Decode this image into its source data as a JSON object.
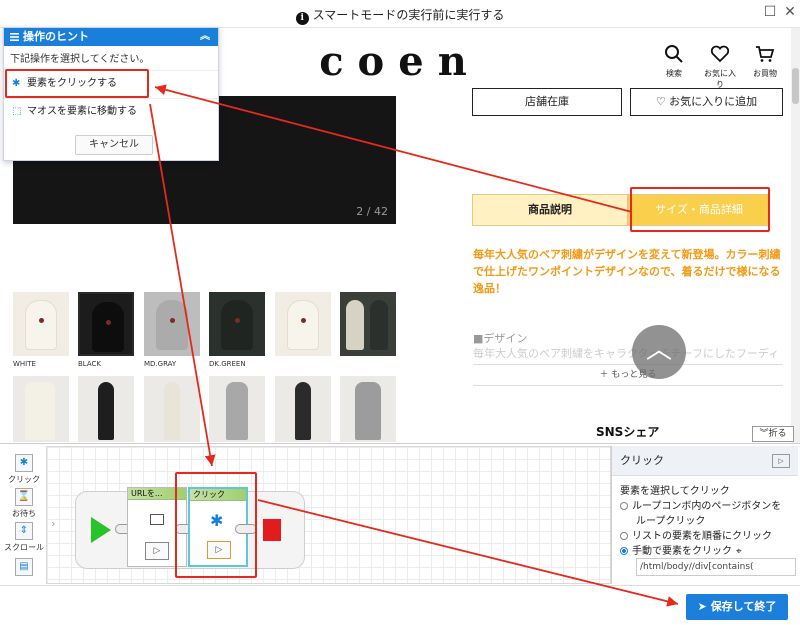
{
  "window": {
    "title": "スマートモードの実行前に実行する",
    "info_icon": "info-icon",
    "restore_symbol": "☐",
    "close_symbol": "✕"
  },
  "site": {
    "logo": "coen",
    "header_icons": [
      {
        "name": "search-icon",
        "label": "検索"
      },
      {
        "name": "heart-icon",
        "label": "お気に入り"
      },
      {
        "name": "cart-icon",
        "label": "お買物"
      }
    ],
    "hero_counter": "2 / 42",
    "buttons": {
      "store_stock": "店舗在庫",
      "add_favorite": "お気に入りに追加"
    },
    "tabs": [
      "商品説明",
      "サイズ・商品詳細"
    ],
    "promo": "毎年大人気のベア刺繍がデザインを変えて新登場。カラー刺繍で仕上げたワンポイントデザインなので、着るだけで様になる逸品！",
    "design_heading": "■デザイン",
    "design_text": "毎年大人気のベア刺繍をキャラクターモチーフにしたフーディ",
    "more": "もっと見る",
    "sns": "SNSシェア",
    "colors": [
      "WHITE",
      "BLACK",
      "MD.GRAY",
      "DK.GREEN"
    ],
    "fab_symbol": "︿"
  },
  "hint": {
    "title": "操作のヒント",
    "subtitle": "下記操作を選択してください。",
    "options": [
      "要素をクリックする",
      "マオスを要素に移動する"
    ],
    "cancel": "キャンセル"
  },
  "designer": {
    "tools": [
      "クリック",
      "お待ち",
      "スクロール"
    ],
    "nodes": [
      "URLを...",
      "クリック"
    ],
    "collapse": "折る",
    "properties": {
      "title": "クリック",
      "section": "要素を選択してクリック",
      "options": [
        "ループコンボ内のページボタンを",
        "ループクリック",
        "リストの要素を順番にクリック",
        "手動で要素をクリック"
      ],
      "xpath": "/html/body//div[contains("
    },
    "save": "保存して終了"
  },
  "colors": {
    "accent": "#1b7fdb",
    "annotation": "#e32a1d",
    "promo": "#f29a18",
    "tab_bg": "#fff6c8"
  }
}
